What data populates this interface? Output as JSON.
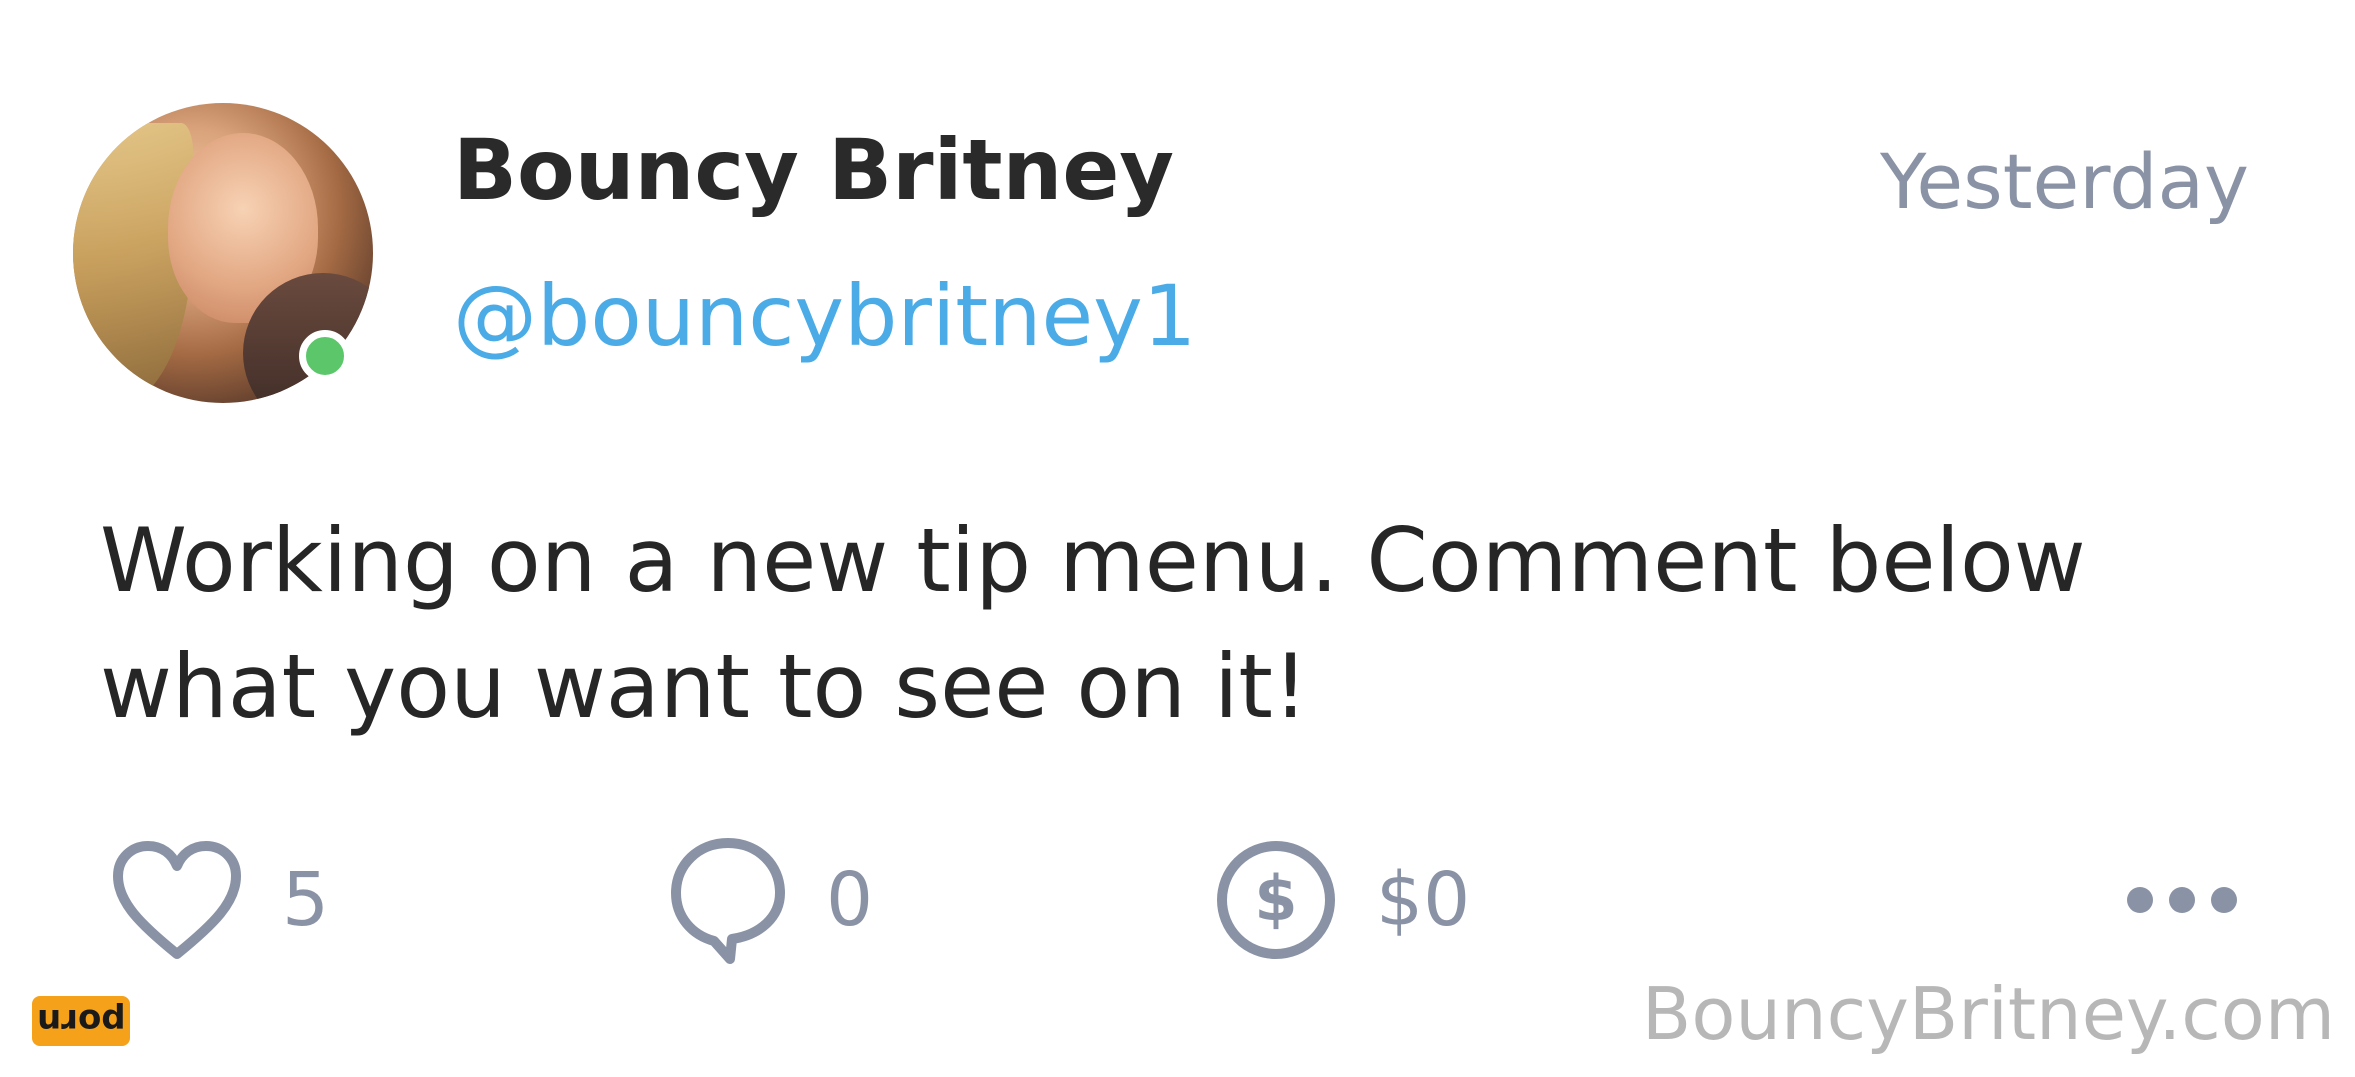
{
  "post": {
    "author_name": "Bouncy Britney",
    "author_handle": "@bouncybritney1",
    "timestamp": "Yesterday",
    "body": "Working on a new tip menu. Comment below what you want to see on it!",
    "online": true
  },
  "actions": {
    "like": {
      "icon": "heart-icon",
      "count": "5"
    },
    "comment": {
      "icon": "speech-bubble-icon",
      "count": "0"
    },
    "tip": {
      "icon": "dollar-circle-icon",
      "amount": "$0"
    },
    "more": {
      "icon": "more-dots-icon"
    }
  },
  "watermark": "BouncyBritney.com",
  "badge": {
    "text": "porn"
  },
  "colors": {
    "name": "#2a2a2a",
    "handle": "#4aabe6",
    "muted": "#8a93a5",
    "online": "#5cc76a",
    "badge": "#f5a11a"
  }
}
